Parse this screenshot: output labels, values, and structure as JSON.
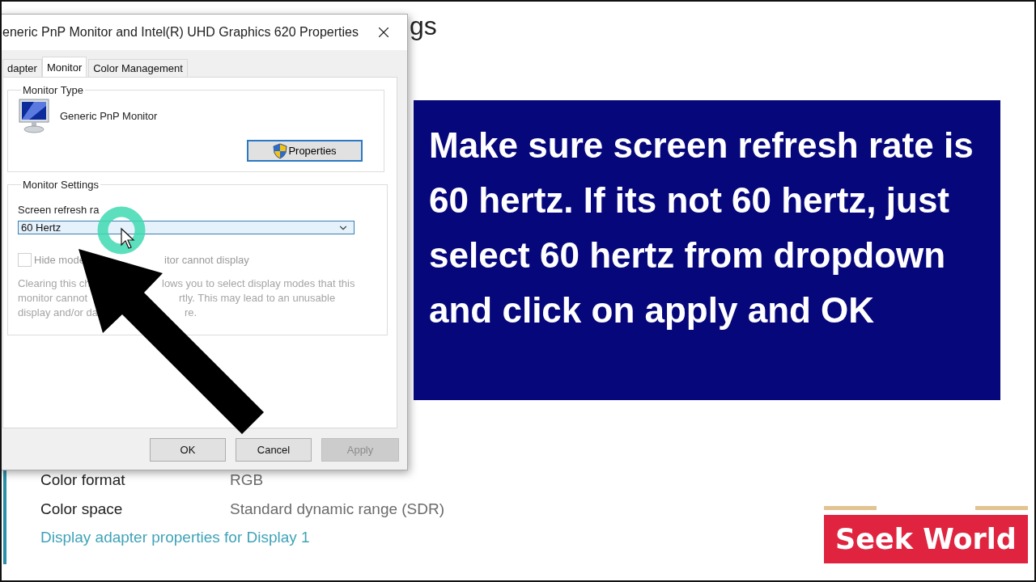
{
  "background_page": {
    "heading_fragment": "gs",
    "rows": [
      {
        "label": "Color format",
        "value": "RGB"
      },
      {
        "label": "Color space",
        "value": "Standard dynamic range (SDR)"
      }
    ],
    "link": "Display adapter properties for Display 1"
  },
  "dialog": {
    "title": "eneric PnP Monitor and Intel(R) UHD Graphics 620 Properties",
    "tabs": [
      {
        "label": "dapter",
        "selected": false
      },
      {
        "label": "Monitor",
        "selected": true
      },
      {
        "label": "Color Management",
        "selected": false
      }
    ],
    "monitor_type": {
      "legend": "Monitor Type",
      "name": "Generic PnP Monitor",
      "button": "Properties"
    },
    "monitor_settings": {
      "legend": "Monitor Settings",
      "refresh_label": "Screen refresh ra",
      "refresh_value": "60 Hertz",
      "hide_modes": {
        "checked": false,
        "disabled": true,
        "label_fragments": [
          "Hide mode",
          "itor cannot display"
        ]
      },
      "description_lines": [
        [
          "Clearing this ch",
          "lows you to select display modes that this"
        ],
        [
          "monitor cannot",
          "rtly. This may lead to an unusable"
        ],
        [
          "display and/or da",
          "re."
        ]
      ]
    },
    "buttons": [
      {
        "label": "OK",
        "disabled": false
      },
      {
        "label": "Cancel",
        "disabled": false
      },
      {
        "label": "Apply",
        "disabled": true
      }
    ]
  },
  "callout": {
    "text": "Make sure screen refresh rate is 60 hertz. If its not 60 hertz, just select 60 hertz from dropdown and click on apply and OK"
  },
  "logo": {
    "text": "Seek World"
  }
}
